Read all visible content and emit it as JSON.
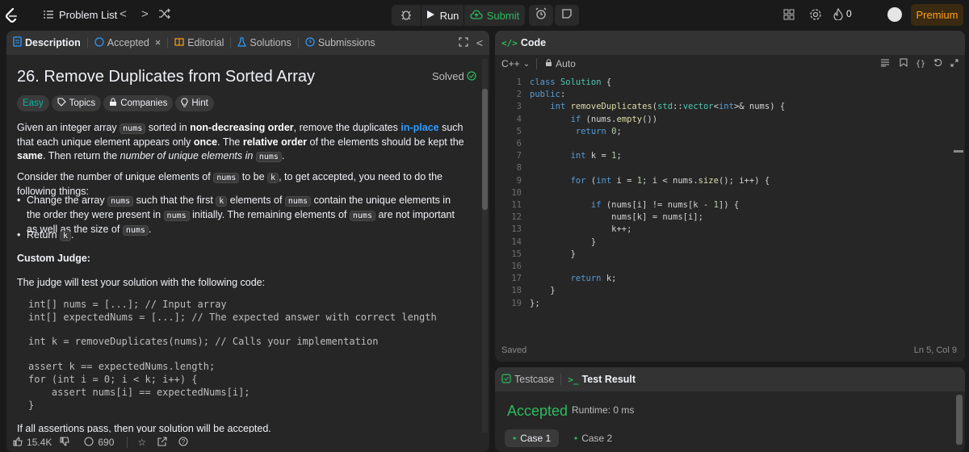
{
  "nav": {
    "problem_list": "Problem List",
    "run": "Run",
    "submit": "Submit",
    "streak_count": "0",
    "premium": "Premium"
  },
  "left_tabs": {
    "description": "Description",
    "accepted": "Accepted",
    "editorial": "Editorial",
    "solutions": "Solutions",
    "submissions": "Submissions"
  },
  "problem": {
    "title": "26. Remove Duplicates from Sorted Array",
    "status": "Solved",
    "chips": {
      "difficulty": "Easy",
      "topics": "Topics",
      "companies": "Companies",
      "hint": "Hint"
    },
    "p1": {
      "a": "Given an integer array ",
      "code1": "nums",
      "b": " sorted in ",
      "bold1": "non-decreasing order",
      "c": ", remove the duplicates ",
      "link": "in-place",
      "d": " such that each unique element appears only ",
      "bold2": "once",
      "e": ". The ",
      "bold3": "relative order",
      "f": " of the elements should be kept the ",
      "bold4": "same",
      "g": ". Then return the ",
      "ital": "number of unique elements in",
      "code2": "nums",
      "h": "."
    },
    "p2": {
      "a": "Consider the number of unique elements of ",
      "code1": "nums",
      "b": " to be ",
      "code2": "k",
      "c": ", to get accepted, you need to do the following things:"
    },
    "b1": {
      "a": "Change the array ",
      "code1": "nums",
      "b": " such that the first ",
      "code2": "k",
      "c": " elements of ",
      "code3": "nums",
      "d": " contain the unique elements in the order they were present in ",
      "code4": "nums",
      "e": " initially. The remaining elements of ",
      "code5": "nums",
      "f": " are not important as well as the size of ",
      "code6": "nums",
      "g": "."
    },
    "b2": {
      "a": "Return ",
      "code1": "k",
      "b": "."
    },
    "custom_judge": "Custom Judge:",
    "judge_text": "The judge will test your solution with the following code:",
    "judge_code1": "int[] nums = [...]; // Input array\nint[] expectedNums = [...]; // The expected answer with correct length",
    "judge_code2": "int k = removeDuplicates(nums); // Calls your implementation",
    "judge_code3": "assert k == expectedNums.length;\nfor (int i = 0; i < k; i++) {\n    assert nums[i] == expectedNums[i];\n}",
    "last_line": "If all assertions pass, then your solution will be accepted."
  },
  "left_footer": {
    "likes": "15.4K",
    "comments": "690"
  },
  "code_panel": {
    "title": "Code",
    "language": "C++",
    "mode": "Auto",
    "line_numbers": [
      "1",
      "2",
      "3",
      "4",
      "5",
      "6",
      "7",
      "8",
      "9",
      "10",
      "11",
      "12",
      "13",
      "14",
      "15",
      "16",
      "17",
      "18",
      "19"
    ],
    "saved": "Saved",
    "cursor": "Ln 5, Col 9"
  },
  "result_panel": {
    "testcase_tab": "Testcase",
    "result_tab": "Test Result",
    "verdict": "Accepted",
    "runtime": "Runtime: 0 ms",
    "case1": "Case 1",
    "case2": "Case 2"
  },
  "colors": {
    "accent_green": "#2cbb5d",
    "premium_orange": "#ffa116",
    "easy_teal": "#00b8a3",
    "link_blue": "#2d9cff"
  }
}
